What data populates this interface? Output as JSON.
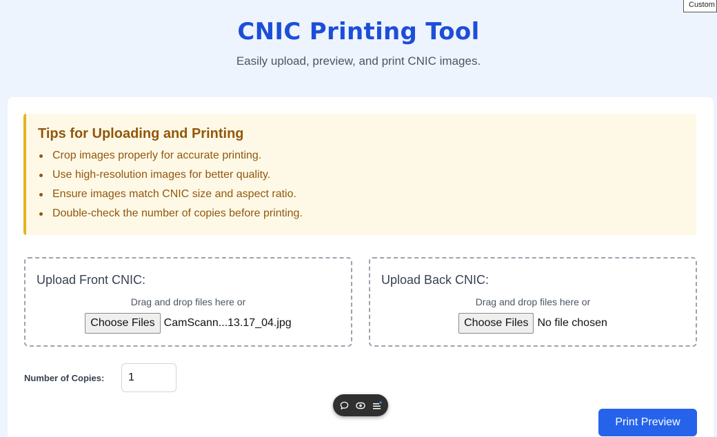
{
  "corner_tag": "Custom",
  "header": {
    "title": "CNIC Printing Tool",
    "subtitle": "Easily upload, preview, and print CNIC images."
  },
  "tips": {
    "title": "Tips for Uploading and Printing",
    "items": [
      "Crop images properly for accurate printing.",
      "Use high-resolution images for better quality.",
      "Ensure images match CNIC size and aspect ratio.",
      "Double-check the number of copies before printing."
    ]
  },
  "front_upload": {
    "label": "Upload Front CNIC:",
    "drag_text": "Drag and drop files here or",
    "button_label": "Choose Files",
    "file_name": "CamScann...13.17_04.jpg"
  },
  "back_upload": {
    "label": "Upload Back CNIC:",
    "drag_text": "Drag and drop files here or",
    "button_label": "Choose Files",
    "file_name": "No file chosen"
  },
  "copies": {
    "label": "Number of Copies:",
    "value": "1"
  },
  "print_preview_label": "Print Preview",
  "floating_toolbar": {
    "icons": [
      "chat-bubble-icon",
      "eye-toggle-icon",
      "menu-list-icon"
    ]
  },
  "colors": {
    "accent": "#1d4ed8",
    "button": "#2563eb",
    "tips_bg": "#fef9e7",
    "tips_border": "#e6b31e",
    "tips_text": "#92560b",
    "page_bg": "#eef4fd"
  }
}
